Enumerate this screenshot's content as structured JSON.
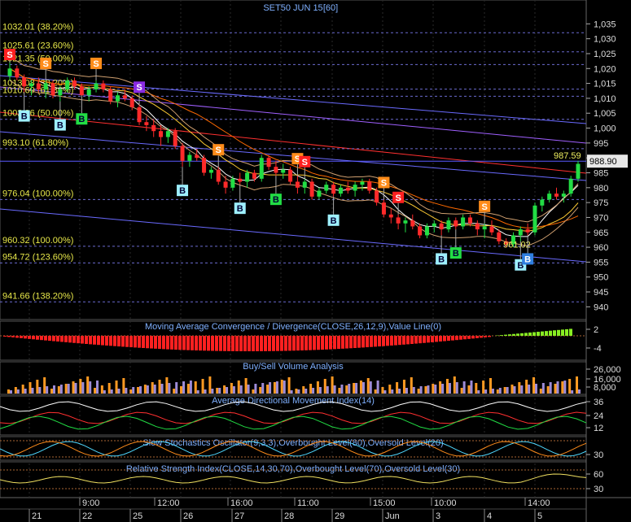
{
  "chart_data": {
    "type": "candlestick",
    "title": "SET50 JUN 15",
    "interval": "[60]",
    "price_axis": {
      "ticks": [
        "1,035",
        "1,030",
        "1,025",
        "1,020",
        "1,015",
        "1,010",
        "1,005",
        "1,000",
        "995",
        "990",
        "985",
        "980",
        "975",
        "970",
        "965",
        "960",
        "955",
        "950",
        "945",
        "940"
      ],
      "last_price": "988.90",
      "ylim": [
        936,
        1037
      ]
    },
    "fib_levels": [
      {
        "label": "1032.01 (38.20%)",
        "value": 1032.01
      },
      {
        "label": "1025.61 (23.60%)",
        "value": 1025.61
      },
      {
        "label": "1021.35 (50.00%)",
        "value": 1021.35
      },
      {
        "label": "1013.08 (38.20%)",
        "value": 1013.08
      },
      {
        "label": "1010.69 (61.80%)",
        "value": 1010.69
      },
      {
        "label": "1002.96 (50.00%)",
        "value": 1002.96
      },
      {
        "label": "993.10 (61.80%)",
        "value": 993.1
      },
      {
        "label": "976.04 (100.00%)",
        "value": 976.04
      },
      {
        "label": "960.32 (100.00%)",
        "value": 960.32
      },
      {
        "label": "954.72 (123.60%)",
        "value": 954.72
      },
      {
        "label": "941.66 (138.20%)",
        "value": 941.66
      }
    ],
    "price_annotations": [
      {
        "label": "987.59",
        "index": 79,
        "value": 987.59
      },
      {
        "label": "961.02",
        "index": 72,
        "value": 961.02
      }
    ],
    "candles": [
      [
        1017.5,
        1022,
        1016,
        1020
      ],
      [
        1020,
        1021,
        1016,
        1017
      ],
      [
        1017,
        1018,
        1012,
        1014
      ],
      [
        1014,
        1016,
        1011,
        1015
      ],
      [
        1015,
        1017,
        1012,
        1013
      ],
      [
        1013,
        1016,
        1010,
        1015
      ],
      [
        1015,
        1016,
        1010,
        1011
      ],
      [
        1011,
        1014,
        1009,
        1013
      ],
      [
        1013,
        1017,
        1012,
        1016
      ],
      [
        1016,
        1017,
        1013,
        1014
      ],
      [
        1014,
        1015,
        1011,
        1011
      ],
      [
        1011,
        1014,
        1009,
        1013
      ],
      [
        1013,
        1016,
        1012,
        1015
      ],
      [
        1015,
        1016,
        1012,
        1013
      ],
      [
        1013,
        1014,
        1008,
        1009
      ],
      [
        1009,
        1012,
        1007,
        1011
      ],
      [
        1011,
        1013,
        1009,
        1010
      ],
      [
        1010,
        1011,
        1006,
        1007
      ],
      [
        1007,
        1008,
        1001,
        1002
      ],
      [
        1002,
        1004,
        999,
        1001
      ],
      [
        1001,
        1003,
        997,
        999
      ],
      [
        999,
        1001,
        994,
        997
      ],
      [
        997,
        1000,
        995,
        999
      ],
      [
        999,
        1000,
        993,
        994
      ],
      [
        994,
        995,
        987,
        989
      ],
      [
        989,
        992,
        987,
        991
      ],
      [
        991,
        993,
        989,
        990
      ],
      [
        990,
        991,
        984,
        985
      ],
      [
        985,
        987,
        983,
        986
      ],
      [
        986,
        987,
        981,
        982
      ],
      [
        982,
        984,
        978,
        980
      ],
      [
        980,
        984,
        979,
        983
      ],
      [
        983,
        985,
        981,
        982
      ],
      [
        982,
        986,
        980,
        985
      ],
      [
        985,
        986,
        982,
        983
      ],
      [
        983,
        991,
        982,
        990
      ],
      [
        990,
        991,
        986,
        987
      ],
      [
        987,
        989,
        984,
        985
      ],
      [
        985,
        988,
        983,
        986
      ],
      [
        986,
        987,
        981,
        982
      ],
      [
        982,
        984,
        978,
        980
      ],
      [
        980,
        983,
        978,
        982
      ],
      [
        982,
        983,
        976,
        977
      ],
      [
        977,
        980,
        976,
        979
      ],
      [
        979,
        982,
        978,
        981
      ],
      [
        981,
        982,
        977,
        978
      ],
      [
        978,
        981,
        977,
        980
      ],
      [
        980,
        982,
        978,
        979
      ],
      [
        979,
        982,
        977,
        981
      ],
      [
        981,
        983,
        979,
        982
      ],
      [
        982,
        983,
        978,
        979
      ],
      [
        979,
        980,
        974,
        975
      ],
      [
        975,
        976,
        970,
        971
      ],
      [
        971,
        973,
        968,
        970
      ],
      [
        970,
        971,
        966,
        968
      ],
      [
        968,
        970,
        965,
        969
      ],
      [
        969,
        971,
        966,
        967
      ],
      [
        967,
        968,
        963,
        964
      ],
      [
        964,
        968,
        963,
        967
      ],
      [
        967,
        969,
        965,
        968
      ],
      [
        968,
        969,
        964,
        966
      ],
      [
        966,
        970,
        965,
        969
      ],
      [
        969,
        970,
        966,
        967
      ],
      [
        967,
        971,
        966,
        970
      ],
      [
        970,
        971,
        967,
        968
      ],
      [
        968,
        969,
        964,
        966
      ],
      [
        966,
        968,
        963,
        967
      ],
      [
        967,
        969,
        964,
        965
      ],
      [
        965,
        966,
        961,
        962
      ],
      [
        962,
        963,
        960,
        961
      ],
      [
        961,
        965,
        960,
        964
      ],
      [
        964,
        967,
        962,
        966
      ],
      [
        966,
        968,
        964,
        965
      ],
      [
        965,
        975,
        964,
        974
      ],
      [
        974,
        977,
        972,
        976
      ],
      [
        976,
        979,
        975,
        978
      ],
      [
        978,
        980,
        976,
        977
      ],
      [
        977,
        979,
        975,
        978
      ],
      [
        978,
        984,
        977,
        983
      ],
      [
        983,
        989,
        982,
        988
      ]
    ],
    "signals": [
      {
        "type": "S",
        "index": 0,
        "color": "#ff2020"
      },
      {
        "type": "S",
        "index": 5,
        "color": "#ff8c1a"
      },
      {
        "type": "S",
        "index": 12,
        "color": "#ff8c1a"
      },
      {
        "type": "S",
        "index": 18,
        "color": "#8a2be2"
      },
      {
        "type": "B",
        "index": 2,
        "color": "#9ef0ff"
      },
      {
        "type": "B",
        "index": 7,
        "color": "#9ef0ff"
      },
      {
        "type": "B",
        "index": 10,
        "color": "#22dd44"
      },
      {
        "type": "S",
        "index": 29,
        "color": "#ff8c1a"
      },
      {
        "type": "B",
        "index": 24,
        "color": "#9ef0ff"
      },
      {
        "type": "B",
        "index": 32,
        "color": "#9ef0ff"
      },
      {
        "type": "B",
        "index": 37,
        "color": "#22dd44"
      },
      {
        "type": "S",
        "index": 40,
        "color": "#ff8c1a"
      },
      {
        "type": "S",
        "index": 41,
        "color": "#ff2020"
      },
      {
        "type": "B",
        "index": 45,
        "color": "#9ef0ff"
      },
      {
        "type": "S",
        "index": 52,
        "color": "#ff8c1a"
      },
      {
        "type": "S",
        "index": 54,
        "color": "#ff2020"
      },
      {
        "type": "B",
        "index": 60,
        "color": "#9ef0ff"
      },
      {
        "type": "B",
        "index": 62,
        "color": "#22dd44"
      },
      {
        "type": "S",
        "index": 66,
        "color": "#ff8c1a"
      },
      {
        "type": "B",
        "index": 71,
        "color": "#9ef0ff"
      },
      {
        "type": "B",
        "index": 72,
        "color": "#2f7fe0"
      }
    ],
    "indicators": {
      "macd": {
        "label": "Moving Average Convergence / Divergence(CLOSE,26,12,9),Value Line(0)",
        "ticks": [
          "2",
          "-4"
        ]
      },
      "volume": {
        "label": "Buy/Sell Volume Analysis",
        "ticks": [
          "26,000",
          "16,000",
          "8,000"
        ]
      },
      "adx": {
        "label": "Average Directional Movement Index(14)",
        "ticks": [
          "36",
          "24",
          "12"
        ]
      },
      "stoch": {
        "label": "Slow Stochastics Oscillator(9,3,3),Overbought Level(80),Oversold Level(20)",
        "ticks": [
          "30"
        ]
      },
      "rsi": {
        "label": "Relative Strength Index(CLOSE,14,30,70),Overbought Level(70),Oversold Level(30)",
        "ticks": [
          "60",
          "30"
        ]
      }
    },
    "x_axis": {
      "time_labels": [
        "9:00",
        "12:00",
        "16:00",
        "11:00",
        "15:00",
        "10:00",
        "14:00"
      ],
      "date_labels": [
        "21",
        "22",
        "25",
        "26",
        "27",
        "28",
        "29",
        "Jun",
        "3",
        "4",
        "5"
      ]
    }
  }
}
